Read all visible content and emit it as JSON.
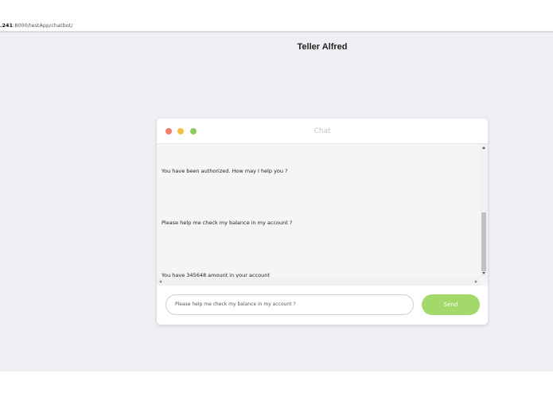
{
  "browser": {
    "url_prefix": ".241",
    "url_rest": ":8000/testApp/chatbot/"
  },
  "page": {
    "title": "Teller Alfred"
  },
  "chat": {
    "window_title": "Chat",
    "messages": [
      "You have been authorized. How may I help you ?",
      "Please help me check my balance in my account ?",
      "You have 345648 amount in your account"
    ],
    "input_value": "Please help me check my balance in my account ?",
    "send_label": "Send"
  },
  "colors": {
    "page_background": "#eeeff3",
    "send_button": "#a3d96a",
    "dot_red": "#f07f6e",
    "dot_yellow": "#f6c043",
    "dot_green": "#8fcc5a"
  }
}
